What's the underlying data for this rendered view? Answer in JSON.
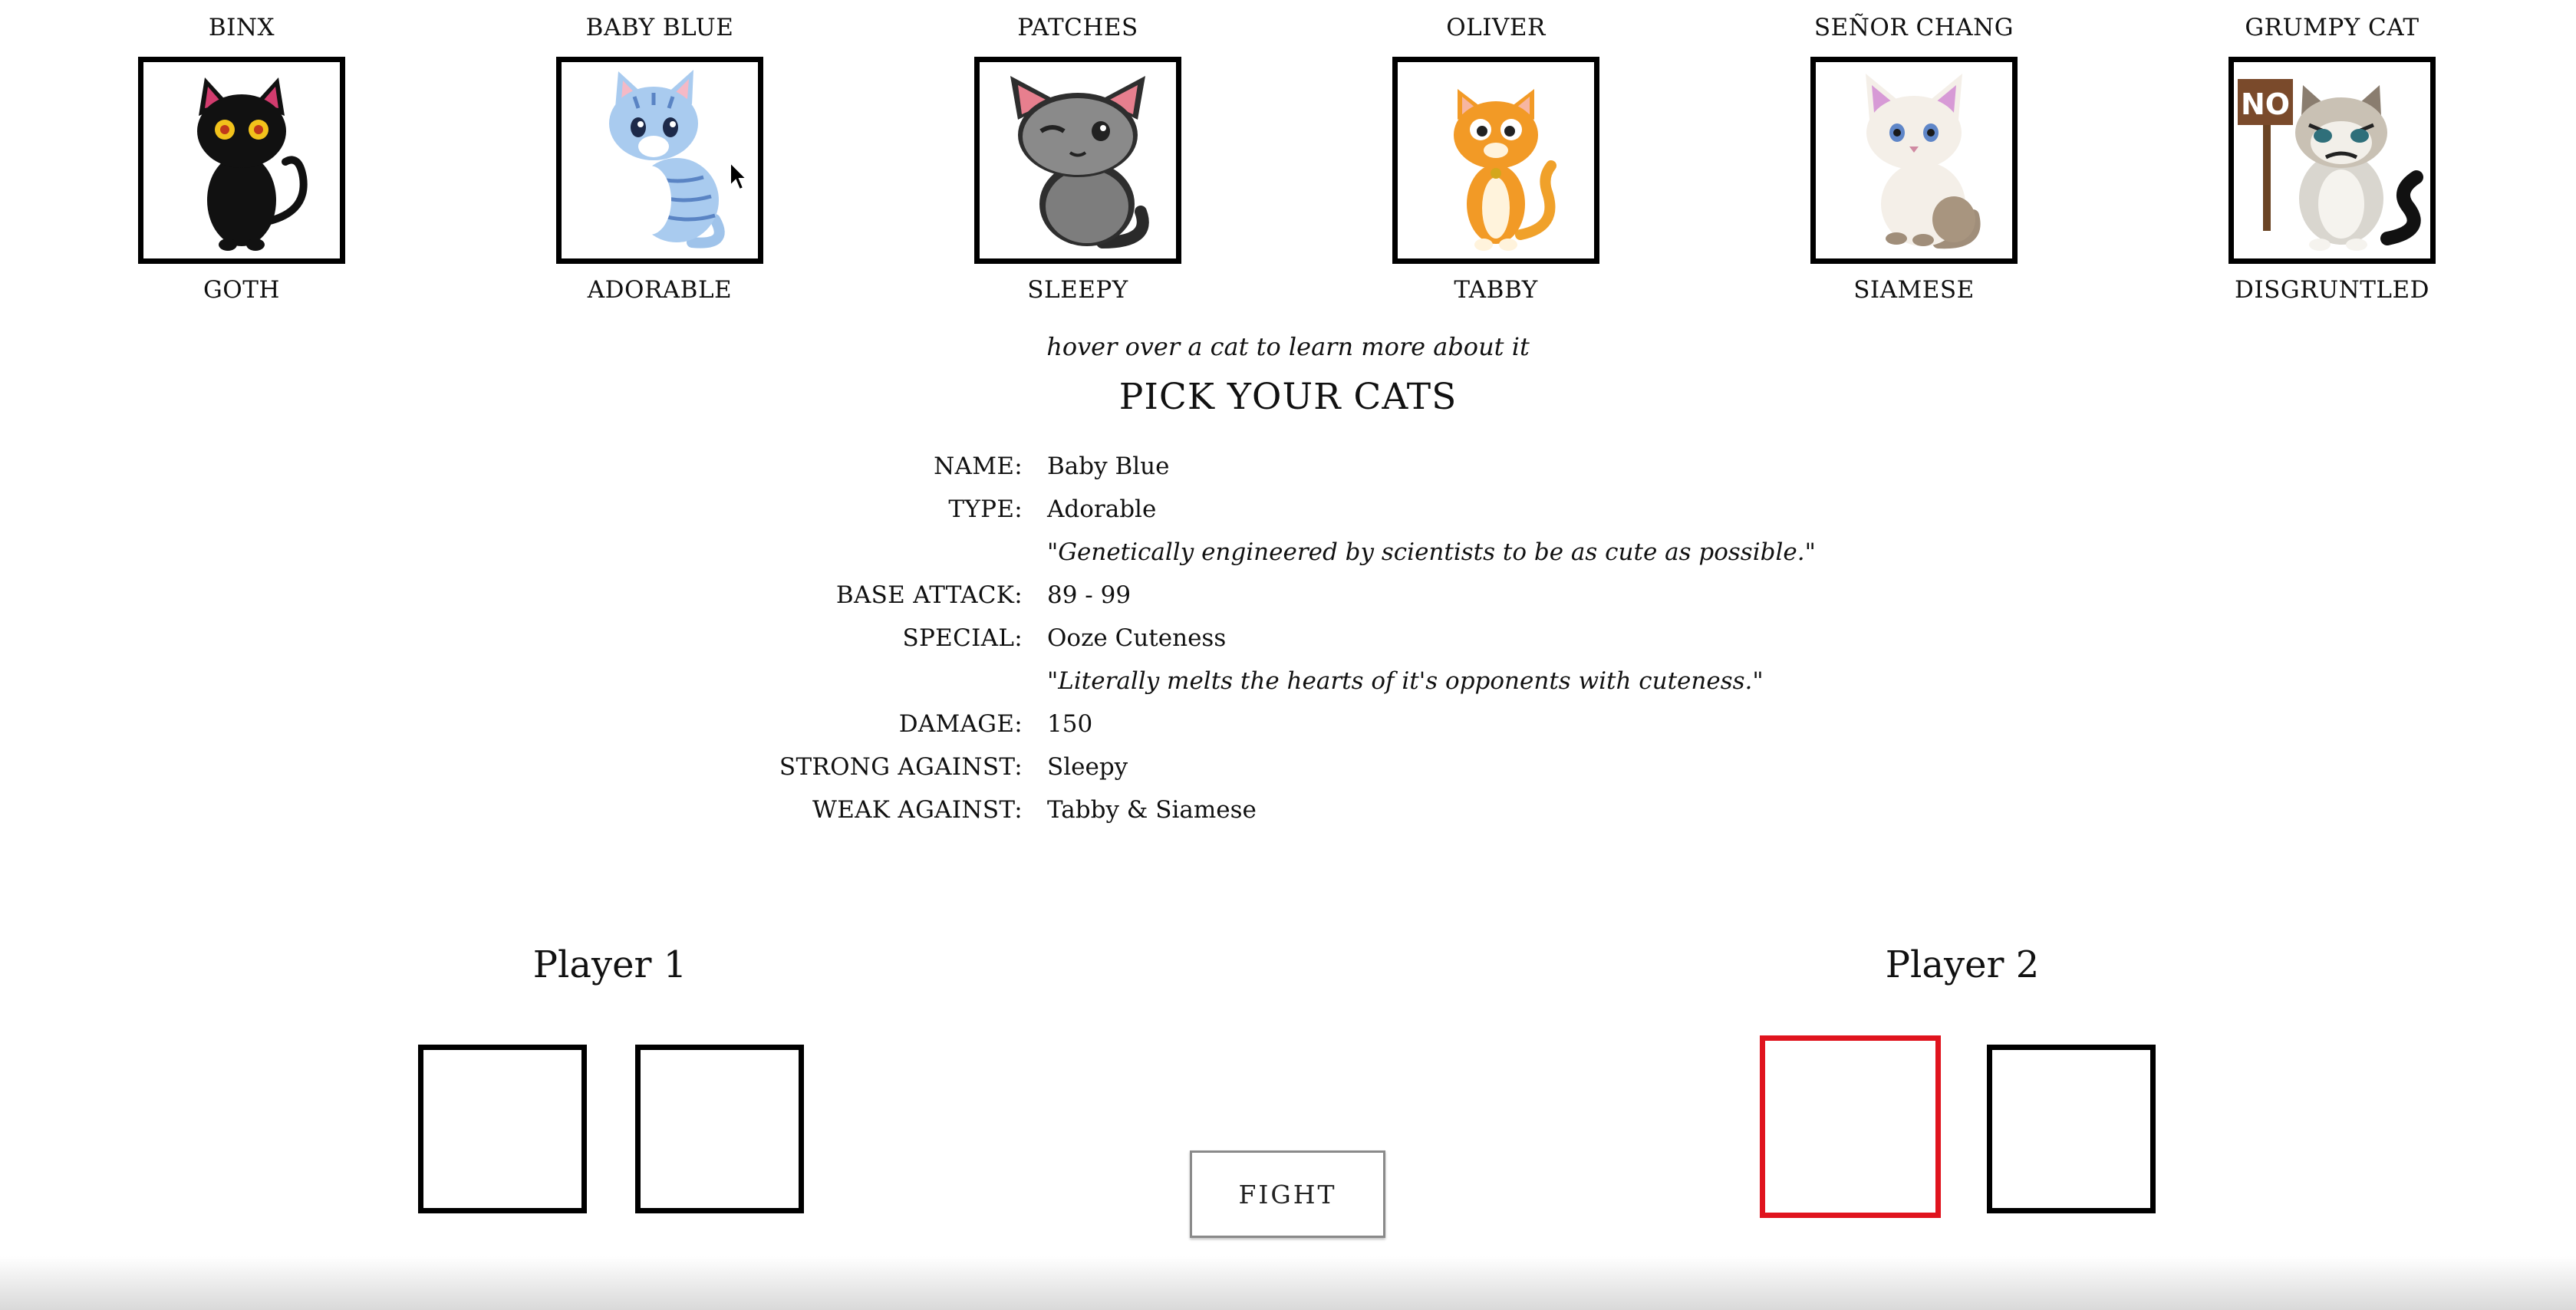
{
  "cats": [
    {
      "name": "BINX",
      "type": "GOTH",
      "icon": "black-cat-icon"
    },
    {
      "name": "BABY BLUE",
      "type": "ADORABLE",
      "icon": "blue-cat-icon"
    },
    {
      "name": "PATCHES",
      "type": "SLEEPY",
      "icon": "gray-cat-icon"
    },
    {
      "name": "OLIVER",
      "type": "TABBY",
      "icon": "orange-cat-icon"
    },
    {
      "name": "SEÑOR CHANG",
      "type": "SIAMESE",
      "icon": "white-cat-icon"
    },
    {
      "name": "GRUMPY CAT",
      "type": "DISGRUNTLED",
      "icon": "grumpy-cat-icon",
      "sign_text": "NO"
    }
  ],
  "hint": "hover over a cat to learn more about it",
  "heading": "PICK YOUR CATS",
  "details": {
    "name_label": "NAME:",
    "name": "Baby Blue",
    "type_label": "TYPE:",
    "type": "Adorable",
    "type_quote": "\"Genetically engineered by scientists to be as cute as possible.\"",
    "base_attack_label": "BASE ATTACK:",
    "base_attack": "89 - 99",
    "special_label": "SPECIAL:",
    "special": "Ooze Cuteness",
    "special_quote": "\"Literally melts the hearts of it's opponents with cuteness.\"",
    "damage_label": "DAMAGE:",
    "damage": "150",
    "strong_label": "STRONG AGAINST:",
    "strong": "Sleepy",
    "weak_label": "WEAK AGAINST:",
    "weak": "Tabby & Siamese"
  },
  "players": [
    {
      "title": "Player 1",
      "slots": 2,
      "active_slot": null
    },
    {
      "title": "Player 2",
      "slots": 2,
      "active_slot": 1
    }
  ],
  "fight_label": "FIGHT",
  "colors": {
    "active_slot_border": "#e0141e",
    "frame_border": "#000000"
  }
}
